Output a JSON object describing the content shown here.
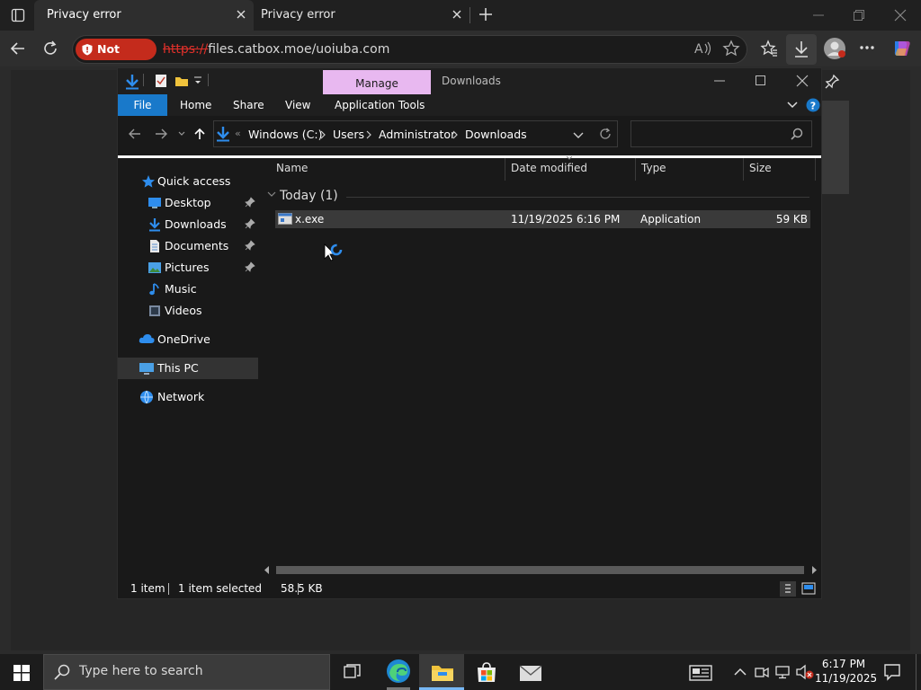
{
  "browser": {
    "tabs": [
      {
        "title": "Privacy error"
      },
      {
        "title": "Privacy error"
      }
    ],
    "not_secure_label": "Not secure",
    "url_scheme": "https://",
    "url_rest": "files.catbox.moe/uoiuba.com"
  },
  "explorer": {
    "manage_label": "Manage",
    "window_title": "Downloads",
    "ribbon_tabs": [
      "File",
      "Home",
      "Share",
      "View",
      "Application Tools"
    ],
    "breadcrumb": [
      "Windows (C:)",
      "Users",
      "Administrator",
      "Downloads"
    ],
    "search_placeholder": "",
    "nav": {
      "quick_access": "Quick access",
      "desktop": "Desktop",
      "downloads": "Downloads",
      "documents": "Documents",
      "pictures": "Pictures",
      "music": "Music",
      "videos": "Videos",
      "onedrive": "OneDrive",
      "this_pc": "This PC",
      "network": "Network"
    },
    "columns": {
      "name": "Name",
      "date": "Date modified",
      "type": "Type",
      "size": "Size"
    },
    "group": "Today (1)",
    "files": [
      {
        "name": "x.exe",
        "date": "11/19/2025 6:16 PM",
        "type": "Application",
        "size": "59 KB"
      }
    ],
    "status": {
      "count": "1 item",
      "selected": "1 item selected",
      "selected_size": "58.5 KB"
    }
  },
  "taskbar": {
    "search_placeholder": "Type here to search",
    "time": "6:17 PM",
    "date": "11/19/2025"
  },
  "colors": {
    "not_secure": "#c42b1c",
    "manage_tab": "#e8b8f0",
    "file_tab": "#1979ca",
    "accent": "#77b7f4"
  }
}
